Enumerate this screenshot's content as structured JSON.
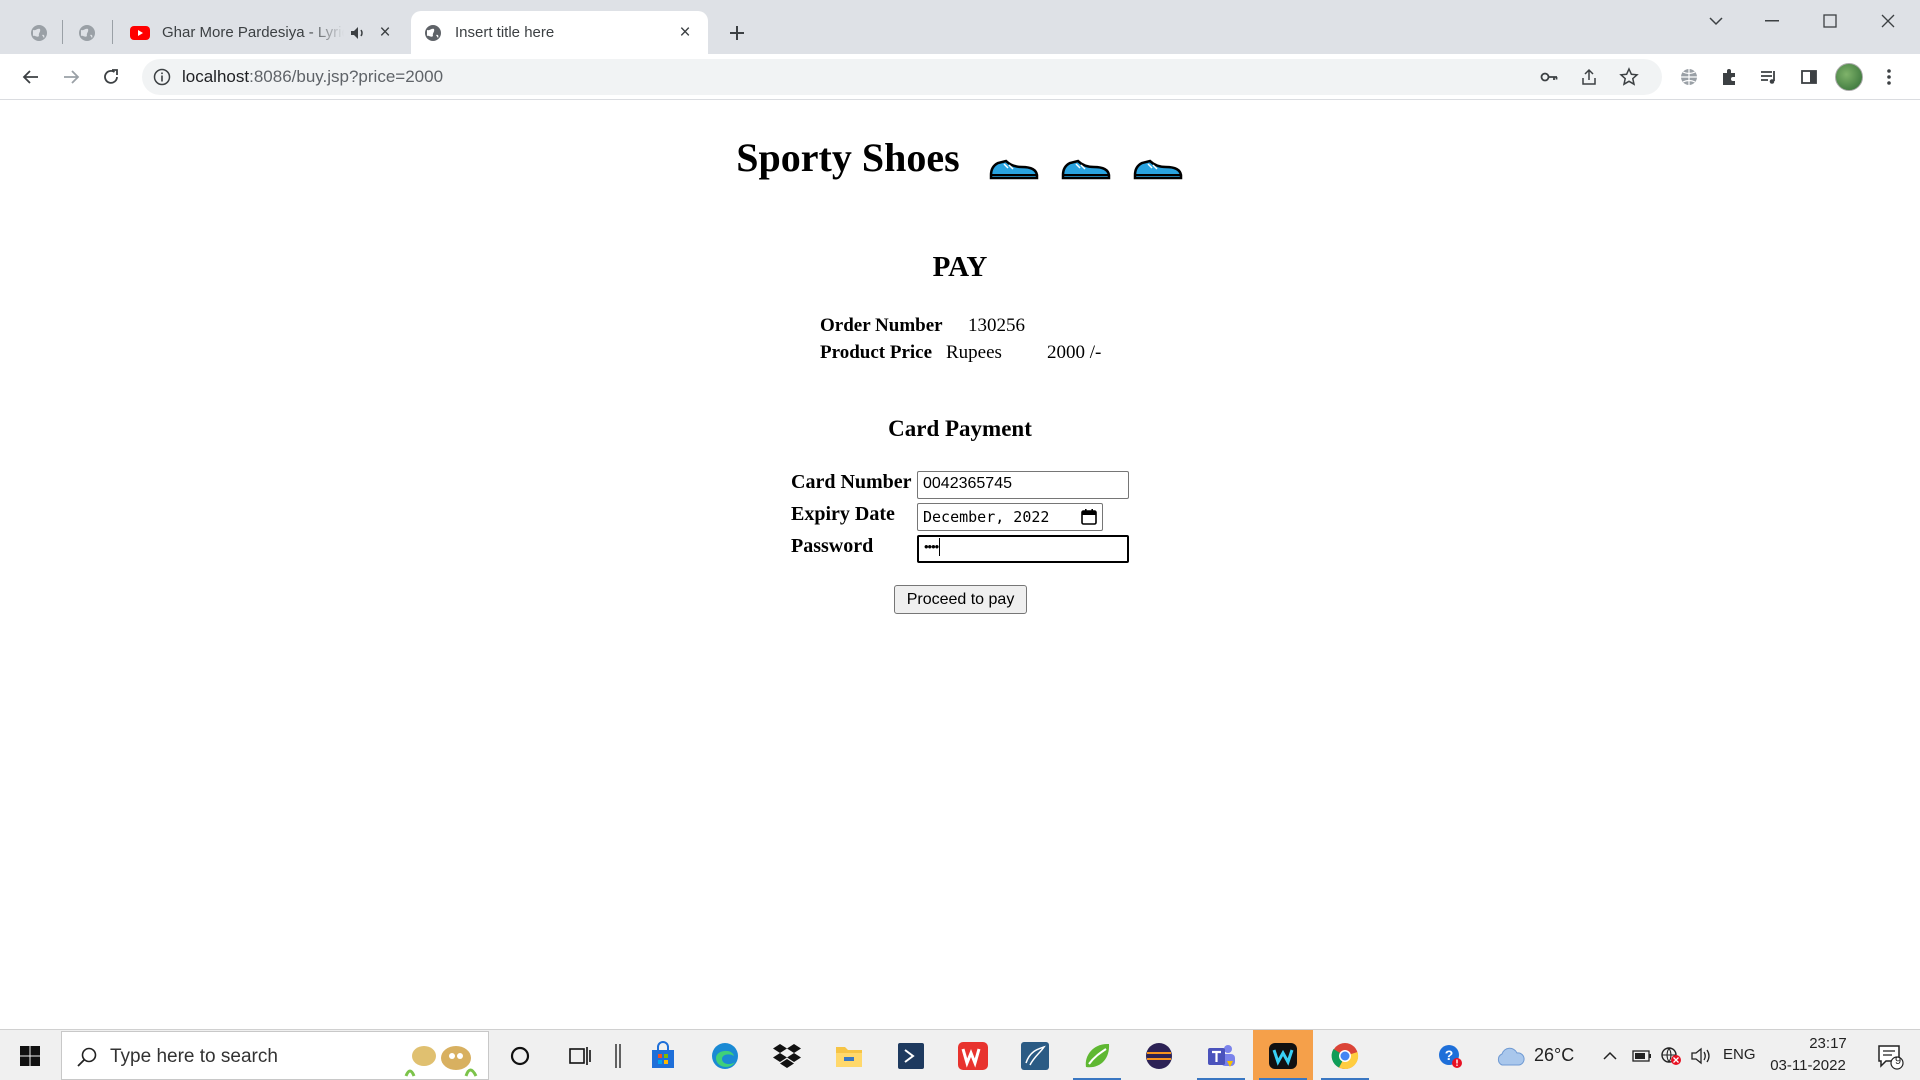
{
  "browser": {
    "tabs": [
      {
        "title": "Ghar More Pardesiya - Lyrical"
      },
      {
        "title": "Insert title here"
      }
    ],
    "url_host": "localhost",
    "url_rest": ":8086/buy.jsp?price=2000"
  },
  "page": {
    "site_title": "Sporty Shoes",
    "pay_heading": "PAY",
    "order_number_label": "Order Number",
    "order_number_value": "130256",
    "price_label": "Product Price",
    "price_currency": "Rupees",
    "price_value": "2000 /-",
    "card_heading": "Card Payment",
    "card_number_label": "Card Number",
    "card_number_value": "0042365745",
    "expiry_label": "Expiry Date",
    "expiry_value": "December, 2022",
    "password_label": "Password",
    "password_value": "••••",
    "proceed_button": "Proceed to pay"
  },
  "taskbar": {
    "search_placeholder": "Type here to search",
    "weather": "26°C",
    "language": "ENG",
    "time": "23:17",
    "date": "03-11-2022",
    "notification_count": "9"
  },
  "colors": {
    "chrome_bg": "#dee1e6",
    "shoe_blue": "#29a3e0",
    "youtube_red": "#ff0000",
    "taskbar_accent": "#3a77c2"
  }
}
